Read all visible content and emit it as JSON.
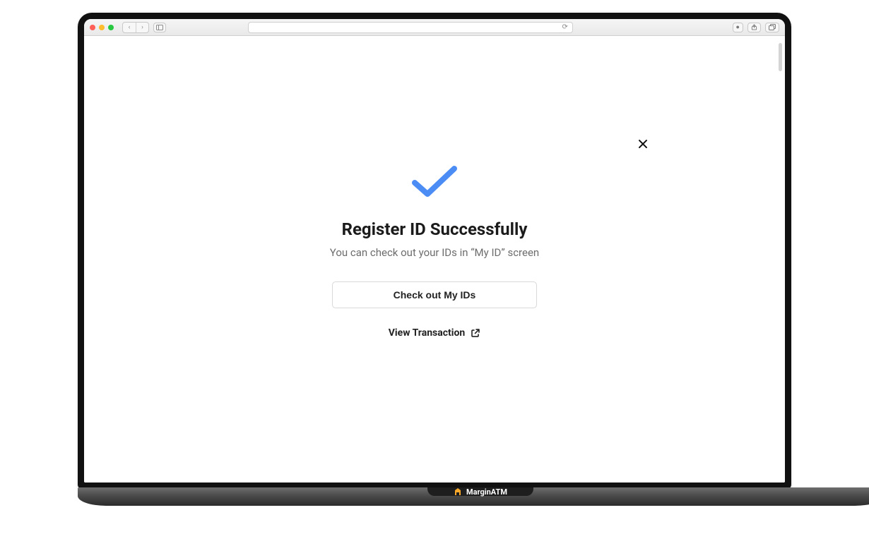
{
  "browser": {
    "back": "‹",
    "forward": "›",
    "reload": "⟳",
    "share": "⇪",
    "tabs": "⧉",
    "shield": "●"
  },
  "modal": {
    "title": "Register ID Successfully",
    "subtitle": "You can check out your IDs in “My ID” screen",
    "check_button_label": "Check out My IDs",
    "view_tx_label": "View Transaction"
  },
  "brand": {
    "name": "MarginATM"
  },
  "colors": {
    "check_blue": "#4b8cf5",
    "text_dark": "#1b1b1b",
    "text_muted": "#6d6d6d",
    "border_gray": "#d9d9d9"
  }
}
